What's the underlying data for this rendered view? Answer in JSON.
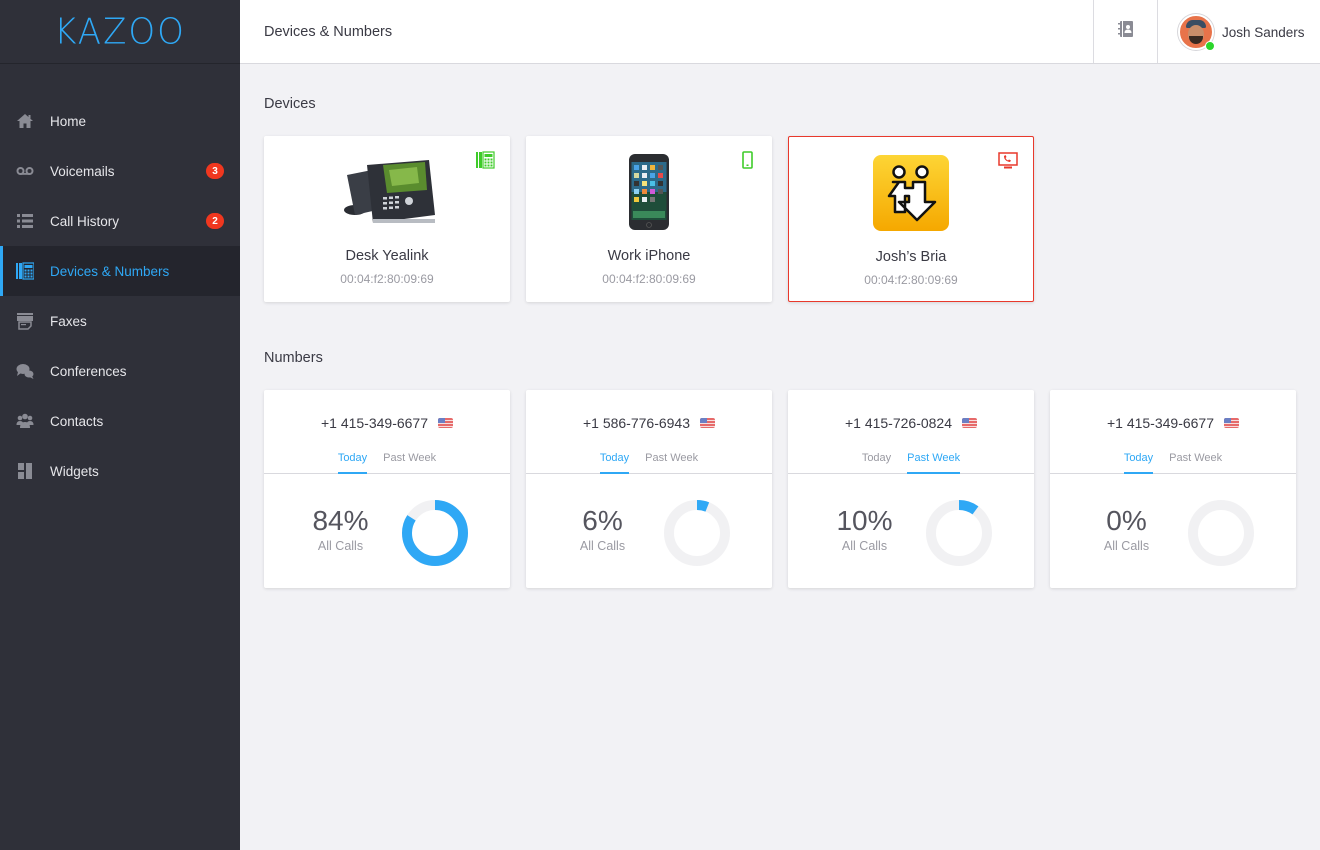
{
  "app": {
    "logo": "KAZOO",
    "accent": "#2fa8f5"
  },
  "sidebar": {
    "items": [
      {
        "label": "Home",
        "icon": "home-icon"
      },
      {
        "label": "Voicemails",
        "icon": "voicemail-icon",
        "badge": "3"
      },
      {
        "label": "Call History",
        "icon": "list-icon",
        "badge": "2"
      },
      {
        "label": "Devices & Numbers",
        "icon": "devices-icon",
        "active": true
      },
      {
        "label": "Faxes",
        "icon": "fax-icon"
      },
      {
        "label": "Conferences",
        "icon": "chat-bubbles-icon"
      },
      {
        "label": "Contacts",
        "icon": "group-icon"
      },
      {
        "label": "Widgets",
        "icon": "widgets-icon"
      }
    ]
  },
  "header": {
    "title": "Devices & Numbers",
    "contacts_icon": "address-book-icon",
    "user": {
      "name": "Josh Sanders",
      "status": "online",
      "status_color": "#2bd52b"
    }
  },
  "devices": {
    "title": "Devices",
    "items": [
      {
        "name": "Desk Yealink",
        "mac": "00:04:f2:80:09:69",
        "type": "desk-phone",
        "type_color": "#3fcc2a",
        "selected": false
      },
      {
        "name": "Work iPhone",
        "mac": "00:04:f2:80:09:69",
        "type": "mobile",
        "type_color": "#3fcc2a",
        "selected": false
      },
      {
        "name": "Josh’s Bria",
        "mac": "00:04:f2:80:09:69",
        "type": "softphone",
        "type_color": "#e8392c",
        "selected": true
      }
    ]
  },
  "numbers": {
    "title": "Numbers",
    "tabs": [
      "Today",
      "Past Week"
    ],
    "stat_label": "All Calls",
    "items": [
      {
        "number": "+1 415-349-6677",
        "country": "US",
        "active_tab": 0,
        "percent": 84,
        "percent_label": "84%"
      },
      {
        "number": "+1 586-776-6943",
        "country": "US",
        "active_tab": 0,
        "percent": 6,
        "percent_label": "6%"
      },
      {
        "number": "+1 415-726-0824",
        "country": "US",
        "active_tab": 1,
        "percent": 10,
        "percent_label": "10%"
      },
      {
        "number": "+1 415-349-6677",
        "country": "US",
        "active_tab": 0,
        "percent": 0,
        "percent_label": "0%"
      }
    ]
  }
}
